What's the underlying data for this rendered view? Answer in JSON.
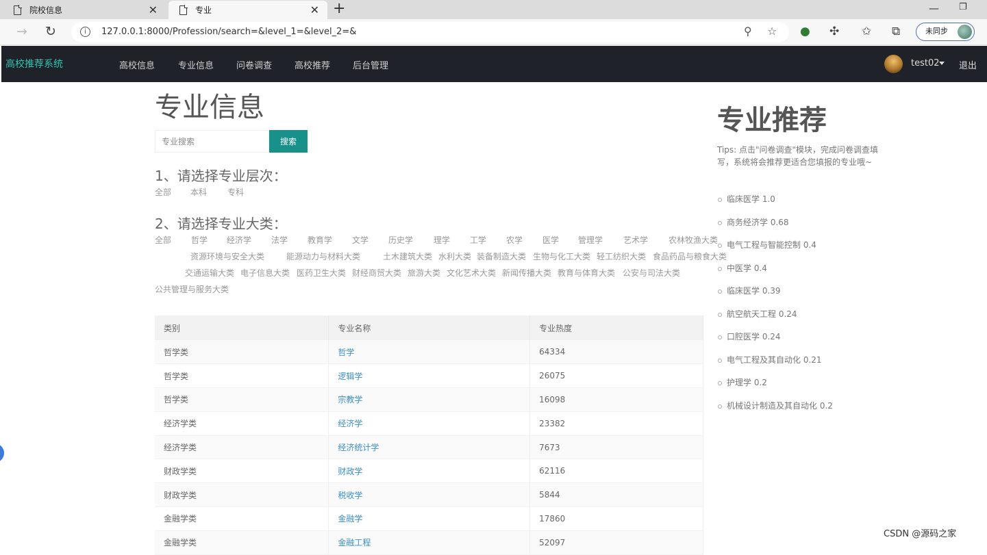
{
  "browser": {
    "tabs": [
      {
        "title": "院校信息",
        "active": false
      },
      {
        "title": "专业",
        "active": true
      }
    ],
    "url": "127.0.0.1:8000/Profession/search=&level_1=&level_2=&",
    "sync_label": "未同步"
  },
  "navbar": {
    "brand": "高校推荐系统",
    "menu": [
      "高校信息",
      "专业信息",
      "问卷调查",
      "高校推荐",
      "后台管理"
    ],
    "username": "test02",
    "logout": "退出"
  },
  "main": {
    "title": "专业信息",
    "search": {
      "placeholder": "专业搜索",
      "button": "搜索"
    },
    "level_title": "1、请选择专业层次：",
    "levels": [
      "全部",
      "本科",
      "专科"
    ],
    "category_title": "2、请选择专业大类：",
    "categories": [
      "全部",
      "哲学",
      "经济学",
      "法学",
      "教育学",
      "文学",
      "历史学",
      "理学",
      "工学",
      "农学",
      "医学",
      "管理学",
      "艺术学",
      "农林牧渔大类",
      "资源环境与安全大类",
      "能源动力与材料大类",
      "土木建筑大类",
      "水利大类",
      "装备制造大类",
      "生物与化工大类",
      "轻工纺织大类",
      "食品药品与粮食大类",
      "交通运输大类",
      "电子信息大类",
      "医药卫生大类",
      "财经商贸大类",
      "旅游大类",
      "文化艺术大类",
      "新闻传播大类",
      "教育与体育大类",
      "公安与司法大类",
      "公共管理与服务大类"
    ],
    "table": {
      "headers": [
        "类别",
        "专业名称",
        "专业热度"
      ],
      "rows": [
        {
          "category": "哲学类",
          "name": "哲学",
          "heat": "64334"
        },
        {
          "category": "哲学类",
          "name": "逻辑学",
          "heat": "26075"
        },
        {
          "category": "哲学类",
          "name": "宗教学",
          "heat": "16098"
        },
        {
          "category": "经济学类",
          "name": "经济学",
          "heat": "23382"
        },
        {
          "category": "经济学类",
          "name": "经济统计学",
          "heat": "7673"
        },
        {
          "category": "财政学类",
          "name": "财政学",
          "heat": "62116"
        },
        {
          "category": "财政学类",
          "name": "税收学",
          "heat": "5844"
        },
        {
          "category": "金融学类",
          "name": "金融学",
          "heat": "17860"
        },
        {
          "category": "金融学类",
          "name": "金融工程",
          "heat": "52097"
        }
      ]
    }
  },
  "sidebar": {
    "title": "专业推荐",
    "tips": "Tips: 点击\"问卷调查\"模块，完成问卷调查填写，系统将会推荐更适合您填报的专业哦~",
    "recommendations": [
      "临床医学 1.0",
      "商务经济学 0.68",
      "电气工程与智能控制 0.4",
      "中医学 0.4",
      "临床医学 0.39",
      "航空航天工程 0.24",
      "口腔医学 0.24",
      "电气工程及其自动化 0.21",
      "护理学 0.2",
      "机械设计制造及其自动化 0.2"
    ]
  },
  "watermark": "CSDN @源码之家",
  "colors": {
    "brand": "#2ec4b3",
    "button": "#17918a",
    "navbar": "#1f2228",
    "link": "#3b8fc9"
  }
}
